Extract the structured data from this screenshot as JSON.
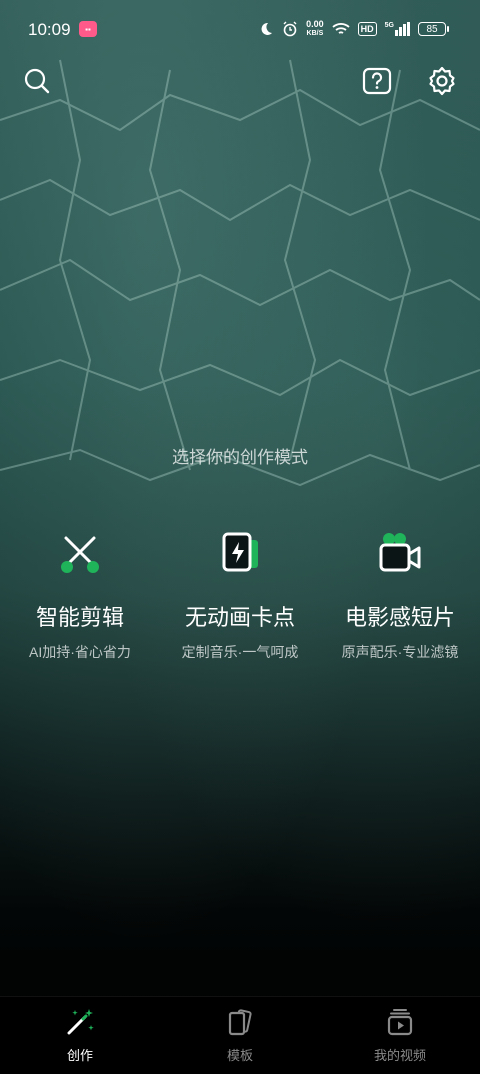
{
  "status_bar": {
    "time": "10:09",
    "net_speed_value": "0.00",
    "net_speed_unit": "KB/S",
    "hd": "HD",
    "network": "5G",
    "battery": "85"
  },
  "main": {
    "prompt": "选择你的创作模式",
    "modes": [
      {
        "title": "智能剪辑",
        "subtitle": "AI加持·省心省力",
        "icon": "scissors-icon"
      },
      {
        "title": "无动画卡点",
        "subtitle": "定制音乐·一气呵成",
        "icon": "flash-card-icon"
      },
      {
        "title": "电影感短片",
        "subtitle": "原声配乐·专业滤镜",
        "icon": "movie-camera-icon"
      }
    ]
  },
  "nav": {
    "items": [
      {
        "label": "创作",
        "icon": "magic-wand-icon",
        "active": true
      },
      {
        "label": "模板",
        "icon": "template-cards-icon",
        "active": false
      },
      {
        "label": "我的视频",
        "icon": "my-videos-icon",
        "active": false
      }
    ]
  },
  "colors": {
    "accent_green": "#1fb35a",
    "background_top": "#2f5a56"
  }
}
